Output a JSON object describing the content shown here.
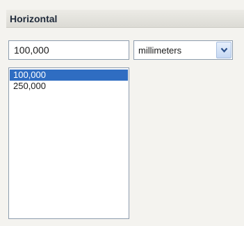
{
  "section": {
    "title": "Horizontal"
  },
  "value_field": {
    "value": "100,000"
  },
  "unit_select": {
    "selected": "millimeters",
    "icon": "chevron-down-icon"
  },
  "value_list": {
    "items": [
      {
        "label": "100,000",
        "selected": true
      },
      {
        "label": "250,000",
        "selected": false
      }
    ]
  },
  "colors": {
    "selection": "#2f6dc2",
    "header": "#dcdbd5",
    "border": "#8d9cad"
  }
}
